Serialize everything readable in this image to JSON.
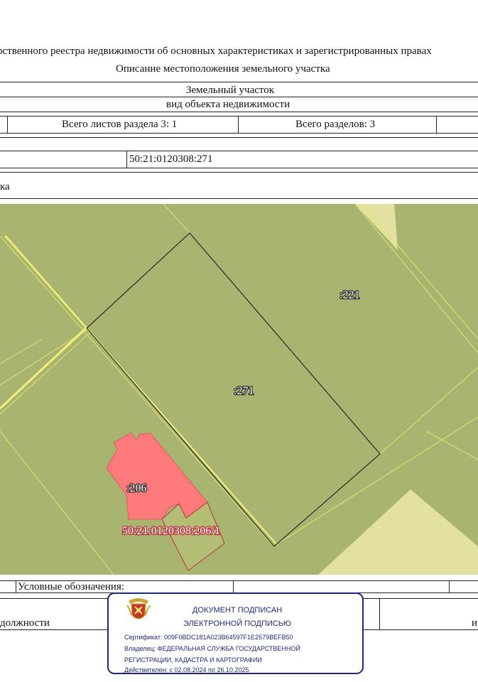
{
  "header": {
    "line1": "рственного реестра недвижимости об основных характеристиках и зарегистрированных правах",
    "line2": "Описание местоположения земельного участка"
  },
  "table": {
    "object_name": "Земельный участок",
    "object_kind_caption": "вид объекта недвижимости",
    "sheets_label": "Всего листов раздела 3: 1",
    "sections_label": "Всего разделов: 3",
    "cadastral_number": "50:21:0120308:271",
    "plan_caption_fragment": "ка"
  },
  "map": {
    "labels": {
      "parcel_271": ":271",
      "parcel_221": ":221",
      "parcel_206": ":206",
      "part_206_1": "50:21:0120308:206/1"
    },
    "colors": {
      "background": "#a9b471",
      "boundary_yellow": "#e6ec6a",
      "building": "#ff7a7a",
      "pale_area": "#e2e1a2",
      "part_label": "#b8323f"
    }
  },
  "legend": {
    "caption": "Условные обозначения:"
  },
  "footer": {
    "position_fragment": "должности",
    "right_fragment": "и"
  },
  "signature_stamp": {
    "title_line1": "ДОКУМЕНТ ПОДПИСАН",
    "title_line2": "ЭЛЕКТРОННОЙ ПОДПИСЬЮ",
    "certificate": "Сертификат: 009F0BDC181A023B64597F1E2579BEFB50",
    "owner_line1": "Владелец: ФЕДЕРАЛЬНАЯ СЛУЖБА ГОСУДАРСТВЕННОЙ",
    "owner_line2": "РЕГИСТРАЦИИ, КАДАСТРА И КАРТОГРАФИИ",
    "validity": "Действителен: с 02.08.2024 по 26.10.2025",
    "colors": {
      "border": "#1f2a7a",
      "emblem": "#c0392b"
    }
  }
}
